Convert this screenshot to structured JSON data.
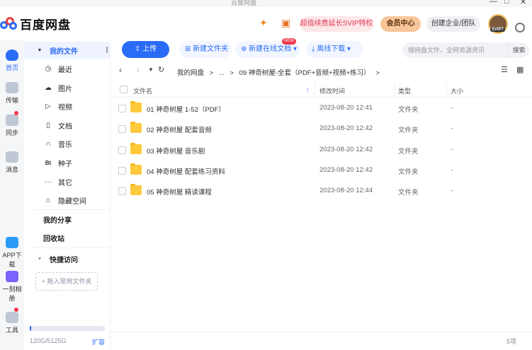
{
  "window": {
    "title": "百度网盘",
    "controls": [
      "—",
      "□",
      "✕"
    ]
  },
  "brand": {
    "name": "百度网盘"
  },
  "header": {
    "promo_label": "超值续费延长SVIP特权",
    "vip_label": "会员中心",
    "enterprise_label": "创建企业/团队",
    "avatar_badge": "SVIP7"
  },
  "rail": [
    {
      "label": "首页",
      "icon": "cloud-icon"
    },
    {
      "label": "传输",
      "icon": "transfer-icon"
    },
    {
      "label": "同步",
      "icon": "sync-icon"
    },
    {
      "label": "消息",
      "icon": "message-icon"
    },
    {
      "label": "APP下载",
      "icon": "app-download-icon"
    },
    {
      "label": "一刻相册",
      "icon": "album-icon"
    },
    {
      "label": "工具",
      "icon": "tools-icon"
    }
  ],
  "sidebar": {
    "root_label": "我的文件",
    "items": [
      {
        "label": "最近",
        "glyph": "◷"
      },
      {
        "label": "图片",
        "glyph": "☁"
      },
      {
        "label": "视频",
        "glyph": "▷"
      },
      {
        "label": "文档",
        "glyph": "▯"
      },
      {
        "label": "音乐",
        "glyph": "∩"
      },
      {
        "label": "种子",
        "glyph": "Bt"
      },
      {
        "label": "其它",
        "glyph": "···"
      },
      {
        "label": "隐藏空间",
        "glyph": "⌂"
      }
    ],
    "share_label": "我的分享",
    "recycle_label": "回收站",
    "quick_label": "快捷访问",
    "add_fav_label": "+ 拖入常用文件夹",
    "quota_text": "120G/5125G",
    "quota_fraction": 0.023,
    "expand_label": "扩容"
  },
  "toolbar": {
    "upload_label": "上传",
    "new_folder_label": "新建文件夹",
    "new_doc_label": "新建在线文档",
    "new_badge": "NEW",
    "offline_label": "离线下载"
  },
  "search": {
    "placeholder": "搜网盘文件、全网资源资讯",
    "button_label": "搜索"
  },
  "breadcrumb": {
    "root": "我的网盘",
    "sep": ">",
    "ellipsis": "...",
    "current": "09 神奇树屋-全套（PDF+音频+视频+练习）"
  },
  "table": {
    "headers": {
      "name": "文件名",
      "modified": "修改时间",
      "type": "类型",
      "size": "大小"
    },
    "rows": [
      {
        "name": "01 神奇树屋 1-52（PDF）",
        "modified": "2023-08-20 12:41",
        "type": "文件夹",
        "size": "-"
      },
      {
        "name": "02 神奇树屋 配套音频",
        "modified": "2023-08-20 12:42",
        "type": "文件夹",
        "size": "-"
      },
      {
        "name": "03 神奇树屋 音乐剧",
        "modified": "2023-08-20 12:42",
        "type": "文件夹",
        "size": "-"
      },
      {
        "name": "04 神奇树屋 配套练习资料",
        "modified": "2023-08-20 12:42",
        "type": "文件夹",
        "size": "-"
      },
      {
        "name": "05 神奇树屋 精读课程",
        "modified": "2023-08-20 12:44",
        "type": "文件夹",
        "size": "-"
      }
    ]
  },
  "status": {
    "count_text": "5项"
  },
  "colors": {
    "accent": "#2b6cf7",
    "folder": "#ffc93c",
    "badge": "#f0384d",
    "vip": "#f9c69a"
  }
}
